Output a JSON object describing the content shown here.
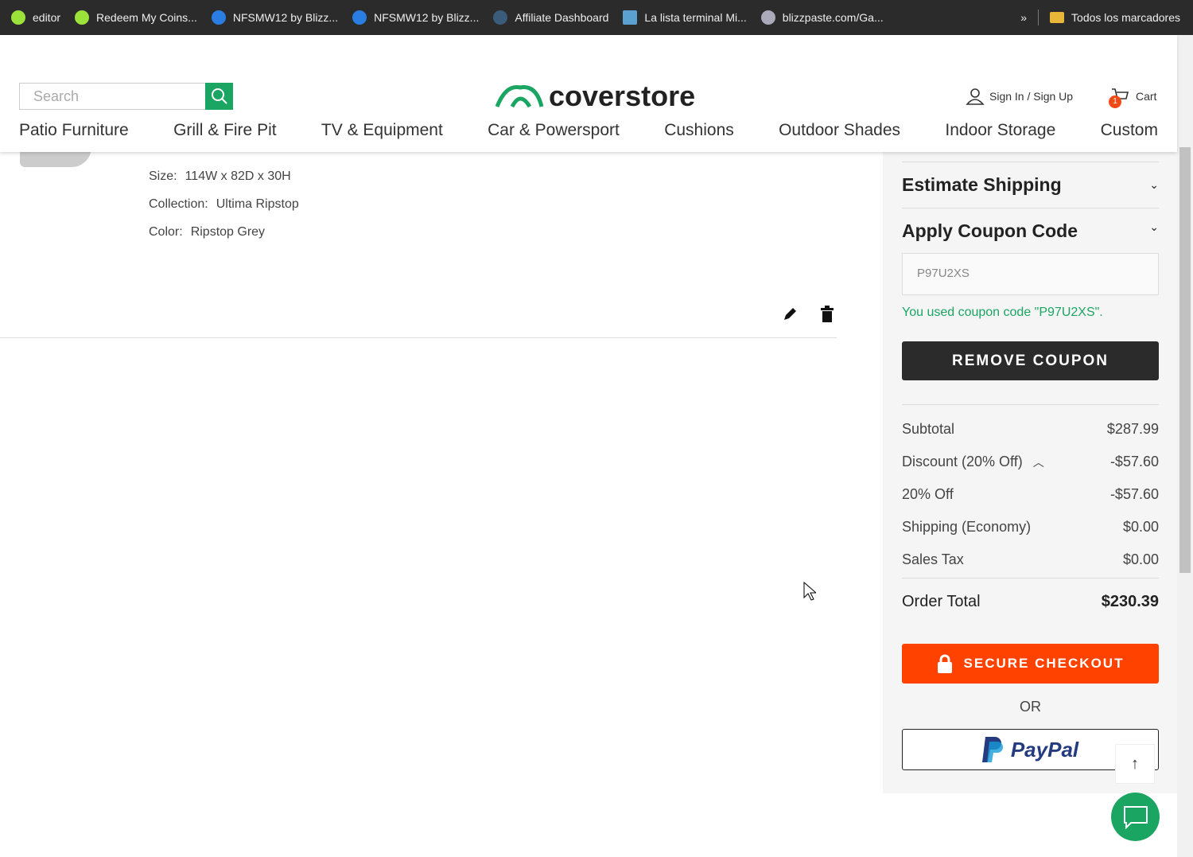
{
  "bookmarks": [
    "editor",
    "Redeem My Coins...",
    "NFSMW12 by Blizz...",
    "NFSMW12 by Blizz...",
    "Affiliate Dashboard",
    "La lista terminal Mi...",
    "blizzpaste.com/Ga..."
  ],
  "bookmarks_overflow": "»",
  "all_bookmarks": "Todos los marcadores",
  "header": {
    "search_placeholder": "Search",
    "logo": "coverstore",
    "sign_in": "Sign In / Sign Up",
    "cart": "Cart",
    "cart_count": "1"
  },
  "nav": [
    "Patio Furniture",
    "Grill & Fire Pit",
    "TV & Equipment",
    "Car & Powersport",
    "Cushions",
    "Outdoor Shades",
    "Indoor Storage",
    "Custom"
  ],
  "item": {
    "details": [
      {
        "label": "Size:",
        "value": "114W x 82D x 30H"
      },
      {
        "label": "Collection:",
        "value": "Ultima Ripstop"
      },
      {
        "label": "Color:",
        "value": "Ripstop Grey"
      }
    ]
  },
  "summary": {
    "estimate_shipping": "Estimate Shipping",
    "apply_coupon": "Apply Coupon Code",
    "coupon_value": "P97U2XS",
    "coupon_msg": "You used coupon code \"P97U2XS\".",
    "remove_coupon": "REMOVE COUPON",
    "rows": [
      {
        "label": "Subtotal",
        "value": "$287.99"
      },
      {
        "label": "Discount (20% Off)",
        "value": "-$57.60"
      },
      {
        "label": "20% Off",
        "value": "-$57.60"
      },
      {
        "label": "Shipping (Economy)",
        "value": "$0.00"
      },
      {
        "label": "Sales Tax",
        "value": "$0.00"
      }
    ],
    "order_total_label": "Order Total",
    "order_total": "$230.39",
    "checkout": "SECURE CHECKOUT",
    "or": "OR",
    "paypal": "PayPal"
  },
  "colors": {
    "brand": "#1aa563",
    "checkout": "#ff4200",
    "dark": "#2b2b2b"
  }
}
